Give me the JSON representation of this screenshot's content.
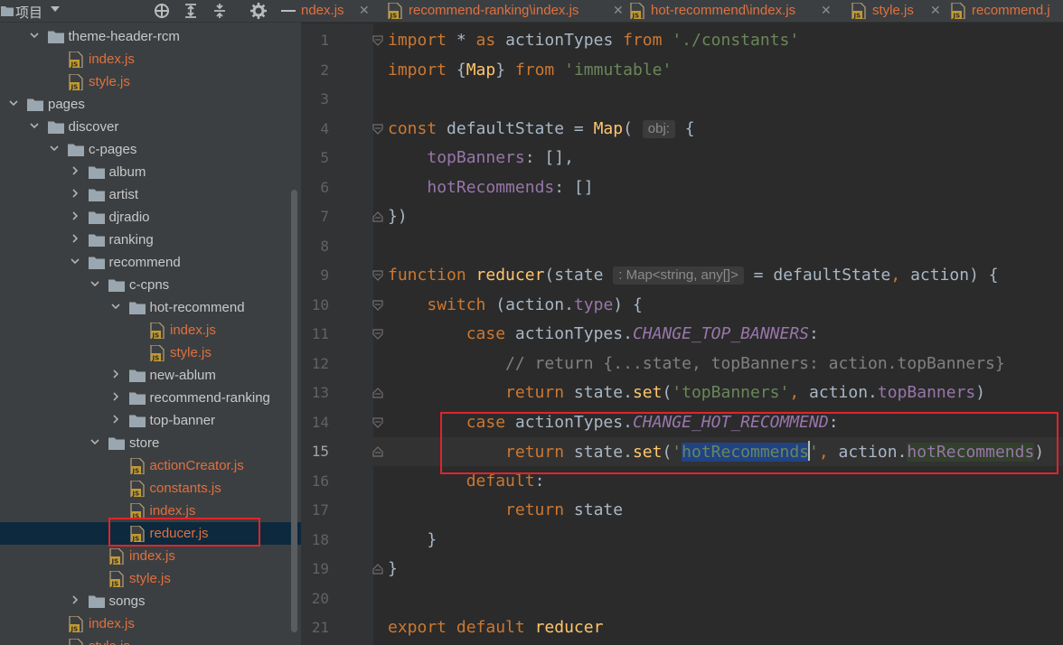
{
  "project_panel": {
    "title": "项目",
    "header_icons": [
      "crosshair-icon",
      "expand-all-icon",
      "collapse-all-icon",
      "gear-icon",
      "minimize-icon"
    ],
    "tree": [
      {
        "label": "theme-header-rcm",
        "type": "folder",
        "state": "expanded"
      },
      {
        "label": "index.js",
        "type": "js"
      },
      {
        "label": "style.js",
        "type": "js"
      },
      {
        "label": "pages",
        "type": "folder",
        "state": "expanded"
      },
      {
        "label": "discover",
        "type": "folder",
        "state": "expanded"
      },
      {
        "label": "c-pages",
        "type": "folder",
        "state": "expanded"
      },
      {
        "label": "album",
        "type": "folder",
        "state": "collapsed"
      },
      {
        "label": "artist",
        "type": "folder",
        "state": "collapsed"
      },
      {
        "label": "djradio",
        "type": "folder",
        "state": "collapsed"
      },
      {
        "label": "ranking",
        "type": "folder",
        "state": "collapsed"
      },
      {
        "label": "recommend",
        "type": "folder",
        "state": "expanded"
      },
      {
        "label": "c-cpns",
        "type": "folder",
        "state": "expanded"
      },
      {
        "label": "hot-recommend",
        "type": "folder",
        "state": "expanded"
      },
      {
        "label": "index.js",
        "type": "js"
      },
      {
        "label": "style.js",
        "type": "js"
      },
      {
        "label": "new-ablum",
        "type": "folder",
        "state": "collapsed"
      },
      {
        "label": "recommend-ranking",
        "type": "folder",
        "state": "collapsed"
      },
      {
        "label": "top-banner",
        "type": "folder",
        "state": "collapsed"
      },
      {
        "label": "store",
        "type": "folder",
        "state": "expanded"
      },
      {
        "label": "actionCreator.js",
        "type": "js"
      },
      {
        "label": "constants.js",
        "type": "js"
      },
      {
        "label": "index.js",
        "type": "js"
      },
      {
        "label": "reducer.js",
        "type": "js",
        "selected": true
      },
      {
        "label": "index.js",
        "type": "js"
      },
      {
        "label": "style.js",
        "type": "js"
      },
      {
        "label": "songs",
        "type": "folder",
        "state": "collapsed"
      },
      {
        "label": "index.js",
        "type": "js"
      },
      {
        "label": "style.js",
        "type": "js"
      }
    ]
  },
  "tabs": [
    {
      "label": "ndex.js"
    },
    {
      "label": "recommend-ranking\\index.js"
    },
    {
      "label": "hot-recommend\\index.js"
    },
    {
      "label": "style.js"
    },
    {
      "label": "recommend.j"
    }
  ],
  "editor": {
    "current_line": 15,
    "lines": [
      {
        "num": "1",
        "fold": "open",
        "tokens": [
          [
            "kw",
            "import"
          ],
          [
            "plain",
            " * "
          ],
          [
            "kw",
            "as"
          ],
          [
            "plain",
            " actionTypes "
          ],
          [
            "kw",
            "from"
          ],
          [
            "plain",
            " "
          ],
          [
            "str",
            "'./constants'"
          ]
        ]
      },
      {
        "num": "2",
        "tokens": [
          [
            "kw",
            "import"
          ],
          [
            "plain",
            " {"
          ],
          [
            "fn",
            "Map"
          ],
          [
            "plain",
            "} "
          ],
          [
            "kw",
            "from"
          ],
          [
            "plain",
            " "
          ],
          [
            "str",
            "'immutable'"
          ]
        ]
      },
      {
        "num": "3",
        "tokens": []
      },
      {
        "num": "4",
        "fold": "open",
        "tokens": [
          [
            "kw",
            "const"
          ],
          [
            "plain",
            " defaultState = "
          ],
          [
            "fn",
            "Map"
          ],
          [
            "plain",
            "( "
          ],
          [
            "hint",
            "obj:"
          ],
          [
            "plain",
            " {"
          ]
        ]
      },
      {
        "num": "5",
        "tokens": [
          [
            "plain",
            "    "
          ],
          [
            "prop",
            "topBanners"
          ],
          [
            "plain",
            ": [],"
          ]
        ]
      },
      {
        "num": "6",
        "tokens": [
          [
            "plain",
            "    "
          ],
          [
            "prop",
            "hotRecommends"
          ],
          [
            "plain",
            ": []"
          ]
        ]
      },
      {
        "num": "7",
        "fold": "close",
        "tokens": [
          [
            "plain",
            "})"
          ]
        ]
      },
      {
        "num": "8",
        "tokens": []
      },
      {
        "num": "9",
        "fold": "open",
        "tokens": [
          [
            "kw",
            "function"
          ],
          [
            "plain",
            " "
          ],
          [
            "fn",
            "reducer"
          ],
          [
            "plain",
            "(state "
          ],
          [
            "hint",
            ": Map<string, any[]>"
          ],
          [
            "plain",
            " = defaultState"
          ],
          [
            "kw",
            ","
          ],
          [
            "plain",
            " action) {"
          ]
        ]
      },
      {
        "num": "10",
        "fold": "open",
        "tokens": [
          [
            "plain",
            "    "
          ],
          [
            "kw",
            "switch"
          ],
          [
            "plain",
            " (action."
          ],
          [
            "prop",
            "type"
          ],
          [
            "plain",
            ") {"
          ]
        ]
      },
      {
        "num": "11",
        "fold": "open",
        "tokens": [
          [
            "plain",
            "        "
          ],
          [
            "kw",
            "case"
          ],
          [
            "plain",
            " actionTypes."
          ],
          [
            "konst",
            "CHANGE_TOP_BANNERS"
          ],
          [
            "plain",
            ":"
          ]
        ]
      },
      {
        "num": "12",
        "tokens": [
          [
            "plain",
            "            "
          ],
          [
            "cmt",
            "// return {...state, topBanners: action.topBanners}"
          ]
        ]
      },
      {
        "num": "13",
        "fold": "close",
        "tokens": [
          [
            "plain",
            "            "
          ],
          [
            "kw",
            "return"
          ],
          [
            "plain",
            " state."
          ],
          [
            "fn",
            "set"
          ],
          [
            "plain",
            "("
          ],
          [
            "str",
            "'topBanners'"
          ],
          [
            "kw",
            ","
          ],
          [
            "plain",
            " action."
          ],
          [
            "prop",
            "topBanners"
          ],
          [
            "plain",
            ")"
          ]
        ]
      },
      {
        "num": "14",
        "fold": "open",
        "tokens": [
          [
            "plain",
            "        "
          ],
          [
            "kw",
            "case"
          ],
          [
            "plain",
            " actionTypes."
          ],
          [
            "konst",
            "CHANGE_HOT_RECOMMEND"
          ],
          [
            "plain",
            ":"
          ]
        ]
      },
      {
        "num": "15",
        "fold": "close",
        "tokens": [
          [
            "plain",
            "            "
          ],
          [
            "kw",
            "return"
          ],
          [
            "plain",
            " state."
          ],
          [
            "fn",
            "set"
          ],
          [
            "plain",
            "("
          ],
          [
            "str",
            "'"
          ],
          [
            "strsel",
            "hotRecommends"
          ],
          [
            "caret",
            ""
          ],
          [
            "str",
            "'"
          ],
          [
            "kw",
            ","
          ],
          [
            "plain",
            " action."
          ],
          [
            "prophl",
            "hotRecommends"
          ],
          [
            "plain",
            ")"
          ]
        ]
      },
      {
        "num": "16",
        "tokens": [
          [
            "plain",
            "        "
          ],
          [
            "kw",
            "default"
          ],
          [
            "plain",
            ":"
          ]
        ]
      },
      {
        "num": "17",
        "tokens": [
          [
            "plain",
            "            "
          ],
          [
            "kw",
            "return"
          ],
          [
            "plain",
            " state"
          ]
        ]
      },
      {
        "num": "18",
        "tokens": [
          [
            "plain",
            "    }"
          ]
        ]
      },
      {
        "num": "19",
        "fold": "close",
        "tokens": [
          [
            "plain",
            "}"
          ]
        ]
      },
      {
        "num": "20",
        "tokens": []
      },
      {
        "num": "21",
        "tokens": [
          [
            "kw",
            "export"
          ],
          [
            "plain",
            " "
          ],
          [
            "kw",
            "default"
          ],
          [
            "plain",
            " "
          ],
          [
            "fn",
            "reducer"
          ]
        ]
      }
    ]
  },
  "colors": {
    "panel_bg": "#3c3f41",
    "editor_bg": "#2b2b2b",
    "gutter_bg": "#313335",
    "js_file_text": "#e0703f",
    "keyword": "#cc7832",
    "string": "#6a8759",
    "function": "#ffc66d",
    "property": "#9876aa",
    "comment": "#808080",
    "selection": "#214283",
    "annotation_box": "#e0242b"
  }
}
